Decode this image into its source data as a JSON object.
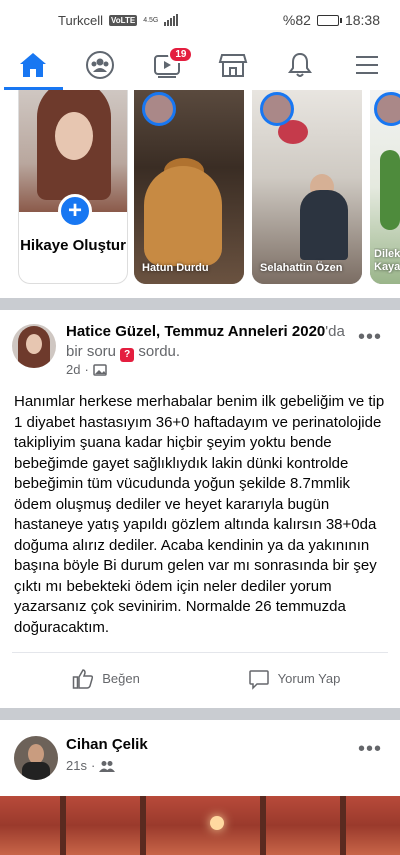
{
  "status_bar": {
    "carrier": "Turkcell",
    "volte": "VoLTE",
    "network": "4.5G",
    "battery": "%82",
    "battery_level": 0.82,
    "time": "18:38"
  },
  "nav": {
    "items": [
      {
        "name": "home",
        "active": true
      },
      {
        "name": "groups"
      },
      {
        "name": "watch",
        "badge": "19"
      },
      {
        "name": "marketplace"
      },
      {
        "name": "notifications"
      },
      {
        "name": "menu"
      }
    ]
  },
  "stories": {
    "create_label": "Hikaye Oluştur",
    "items": [
      {
        "name": "Hatun Durdu"
      },
      {
        "name": "Selahattin Özen"
      },
      {
        "name": "Dilek Kaya"
      }
    ]
  },
  "post": {
    "author": "Hatice Güzel",
    "group": "Temmuz Anneleri 2020",
    "group_suffix": "'da",
    "action_prefix": "bir soru",
    "action_suffix": "sordu.",
    "question_badge": "?",
    "time": "2d",
    "body": "Hanımlar herkese merhabalar benim ilk gebeliğim ve tip 1 diyabet hastasıyım 36+0 haftadayım ve perinatolojide takipliyim şuana kadar hiçbir şeyim yoktu bende bebeğimde gayet sağlıklıydık lakin dünki kontrolde bebeğimin tüm vücudunda yoğun şekilde 8.7mmlik ödem oluşmuş dediler ve heyet kararıyla bugün hastaneye yatış yapıldı gözlem altında kalırsın 38+0da doğuma alırız dediler. Acaba kendinin ya da yakınının başına böyle Bi durum gelen var mı sonrasında bir şey çıktı mı bebekteki ödem için neler dediler yorum yazarsanız çok sevinirim. Normalde 26 temmuzda doğuracaktım.",
    "like_label": "Beğen",
    "comment_label": "Yorum Yap"
  },
  "post2": {
    "author": "Cihan Çelik",
    "time": "21s"
  }
}
